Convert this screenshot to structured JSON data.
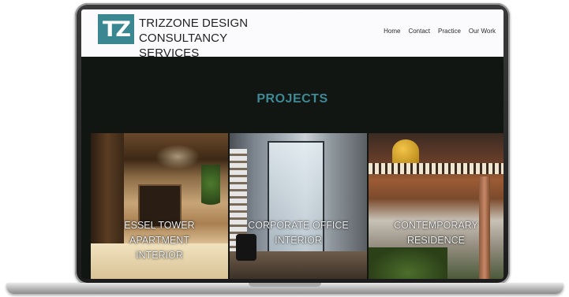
{
  "header": {
    "logo_text": "TZ",
    "brand_line_1": "TRIZZONE DESIGN",
    "brand_line_2": "CONSULTANCY SERVICES",
    "nav": [
      "Home",
      "Contact",
      "Practice",
      "Our Work"
    ]
  },
  "projects": {
    "title": "PROJECTS",
    "items": [
      {
        "line_1": "ESSEL TOWER",
        "line_2": "APARTMENT",
        "line_3": "INTERIOR"
      },
      {
        "line_1": "CORPORATE OFFICE",
        "line_2": "INTERIOR"
      },
      {
        "line_1": "CONTEMPORARY",
        "line_2": "RESIDENCE"
      }
    ]
  },
  "colors": {
    "accent": "#3b8791",
    "title": "#3e8a96",
    "page_background": "#111612",
    "header_background": "#fbfafd"
  }
}
